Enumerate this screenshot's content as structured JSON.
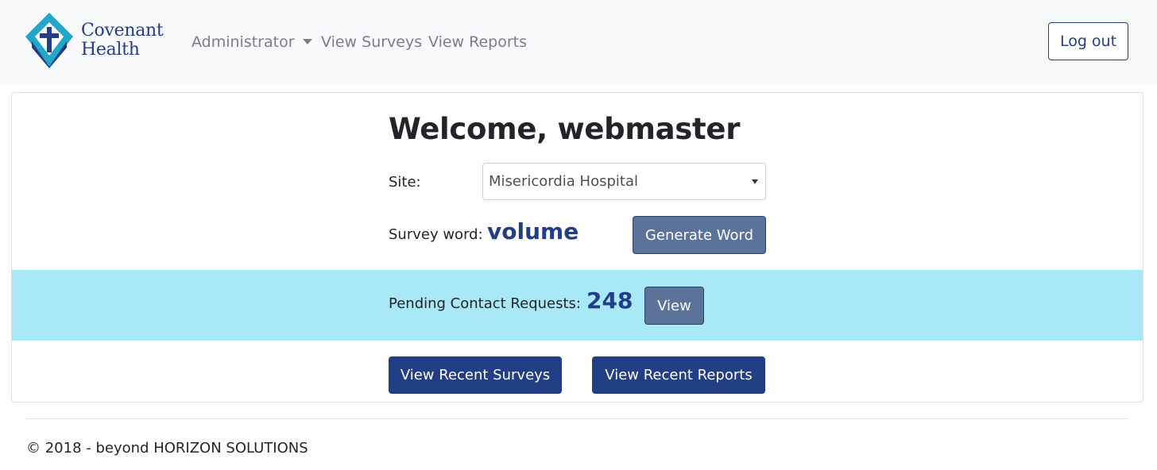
{
  "brand": {
    "name_line1": "Covenant",
    "name_line2": "Health",
    "colors": {
      "navy": "#223f86",
      "teal": "#22a6c9"
    }
  },
  "nav": {
    "items": [
      {
        "label": "Administrator",
        "has_dropdown": true
      },
      {
        "label": "View Surveys"
      },
      {
        "label": "View Reports"
      }
    ],
    "logout_label": "Log out"
  },
  "main": {
    "welcome": "Welcome, webmaster",
    "site_label": "Site:",
    "site_value": "Misericordia Hospital",
    "survey_word_label": "Survey word:",
    "survey_word": "volume",
    "generate_label": "Generate Word",
    "pending_label": "Pending Contact Requests:",
    "pending_count": "248",
    "view_label": "View",
    "recent_surveys_label": "View Recent Surveys",
    "recent_reports_label": "View Recent Reports"
  },
  "footer": {
    "text": "© 2018 - beyond HORIZON SOLUTIONS"
  }
}
